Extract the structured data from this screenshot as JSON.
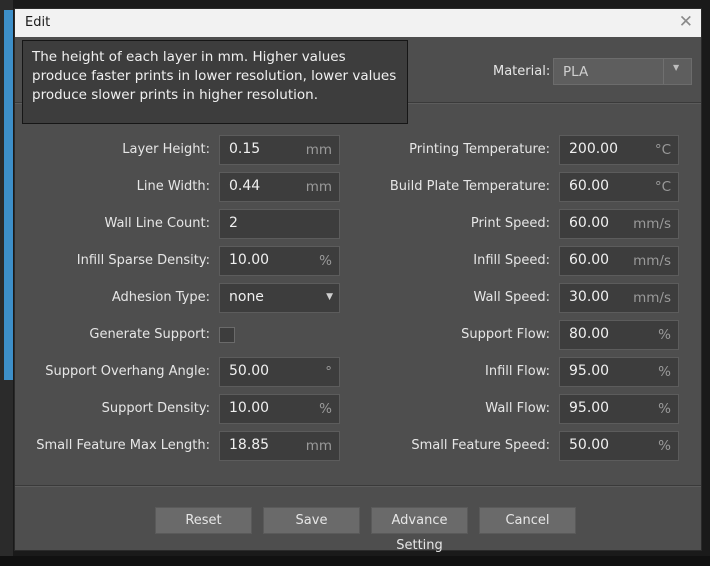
{
  "window": {
    "title": "Edit"
  },
  "tooltip": {
    "text": "The height of each layer in mm. Higher values produce faster prints in lower resolution, lower values produce slower prints in higher resolution."
  },
  "material": {
    "label": "Material:",
    "value": "PLA"
  },
  "left_fields": [
    {
      "label": "Layer Height:",
      "value": "0.15",
      "unit": "mm"
    },
    {
      "label": "Line Width:",
      "value": "0.44",
      "unit": "mm"
    },
    {
      "label": "Wall Line Count:",
      "value": "2",
      "unit": ""
    },
    {
      "label": "Infill Sparse Density:",
      "value": "10.00",
      "unit": "%"
    },
    {
      "label": "Adhesion Type:",
      "value": "none",
      "unit": ""
    },
    {
      "label": "Generate Support:",
      "value": "",
      "unit": ""
    },
    {
      "label": "Support Overhang Angle:",
      "value": "50.00",
      "unit": "°"
    },
    {
      "label": "Support Density:",
      "value": "10.00",
      "unit": "%"
    },
    {
      "label": "Small Feature Max Length:",
      "value": "18.85",
      "unit": "mm"
    }
  ],
  "right_fields": [
    {
      "label": "Printing Temperature:",
      "value": "200.00",
      "unit": "°C"
    },
    {
      "label": "Build Plate Temperature:",
      "value": "60.00",
      "unit": "°C"
    },
    {
      "label": "Print Speed:",
      "value": "60.00",
      "unit": "mm/s"
    },
    {
      "label": "Infill Speed:",
      "value": "60.00",
      "unit": "mm/s"
    },
    {
      "label": "Wall Speed:",
      "value": "30.00",
      "unit": "mm/s"
    },
    {
      "label": "Support Flow:",
      "value": "80.00",
      "unit": "%"
    },
    {
      "label": "Infill Flow:",
      "value": "95.00",
      "unit": "%"
    },
    {
      "label": "Wall Flow:",
      "value": "95.00",
      "unit": "%"
    },
    {
      "label": "Small Feature Speed:",
      "value": "50.00",
      "unit": "%"
    }
  ],
  "generate_support_checked": false,
  "buttons": {
    "reset": "Reset",
    "save": "Save",
    "advance": "Advance Setting",
    "cancel": "Cancel"
  },
  "icons": {
    "close": "close-icon",
    "dropdown": "chevron-down-icon"
  },
  "colors": {
    "dialog_bg": "#4e4e4e",
    "field_bg": "#3d3d3d",
    "titlebar_bg": "#f2f2f2",
    "accent_blue": "#3d8fc9"
  }
}
